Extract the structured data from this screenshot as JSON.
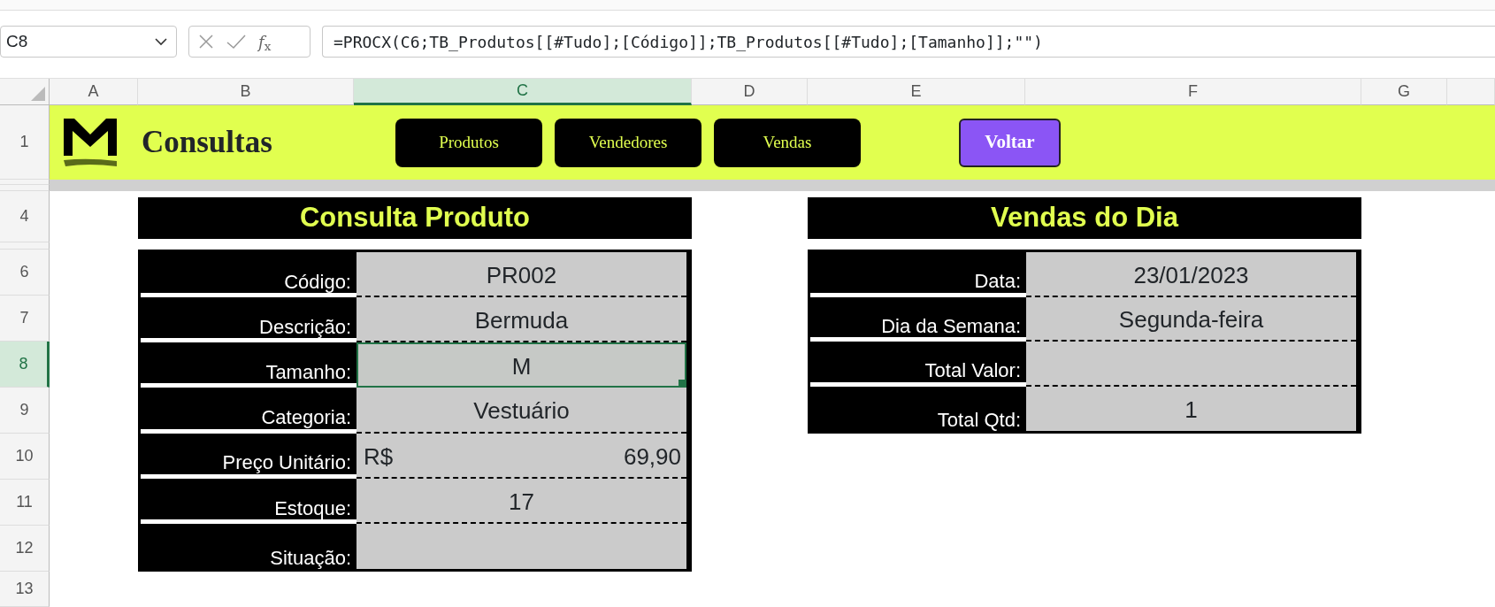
{
  "formula_bar": {
    "cell_reference": "C8",
    "insert_function": "*f*$_{x}$",
    "formula": "=PROCX(C6;TB_Produtos[[#Tudo];[Código]];TB_Produtos[[#Tudo];[Tamanho]];\"\")"
  },
  "columns": [
    {
      "label": "A",
      "selected": false
    },
    {
      "label": "B",
      "selected": false
    },
    {
      "label": "C",
      "selected": true
    },
    {
      "label": "D",
      "selected": false
    },
    {
      "label": "E",
      "selected": false
    },
    {
      "label": "F",
      "selected": false
    },
    {
      "label": "G",
      "selected": false
    }
  ],
  "rows": [
    {
      "label": "1",
      "selected": false
    },
    {
      "label": "4",
      "selected": false
    },
    {
      "label": "6",
      "selected": false
    },
    {
      "label": "7",
      "selected": false
    },
    {
      "label": "8",
      "selected": true
    },
    {
      "label": "9",
      "selected": false
    },
    {
      "label": "10",
      "selected": false
    },
    {
      "label": "11",
      "selected": false
    },
    {
      "label": "12",
      "selected": false
    },
    {
      "label": "13",
      "selected": false
    }
  ],
  "banner": {
    "title": "Consultas",
    "nav_buttons": [
      "Produtos",
      "Vendedores",
      "Vendas"
    ],
    "back_button": "Voltar"
  },
  "panels": [
    {
      "title": "Consulta Produto",
      "fields": [
        {
          "label": "Código:",
          "value": "PR002",
          "selected": false
        },
        {
          "label": "Descrição:",
          "value": "Bermuda",
          "selected": false
        },
        {
          "label": "Tamanho:",
          "value": "M",
          "selected": true
        },
        {
          "label": "Categoria:",
          "value": "Vestuário",
          "selected": false
        },
        {
          "label": "Preço Unitário:",
          "currency": "R$",
          "value": "69,90",
          "selected": false
        },
        {
          "label": "Estoque:",
          "value": "17",
          "selected": false
        },
        {
          "label": "Situação:",
          "selected": false
        }
      ]
    },
    {
      "title": "Vendas do Dia",
      "fields": [
        {
          "label": "Data:",
          "value": "23/01/2023",
          "selected": false
        },
        {
          "label": "Dia da Semana:",
          "value": "Segunda-feira",
          "selected": false
        },
        {
          "label": "Total Valor:",
          "selected": false
        },
        {
          "label": "Total Qtd:",
          "value": "1",
          "selected": false
        }
      ]
    }
  ]
}
